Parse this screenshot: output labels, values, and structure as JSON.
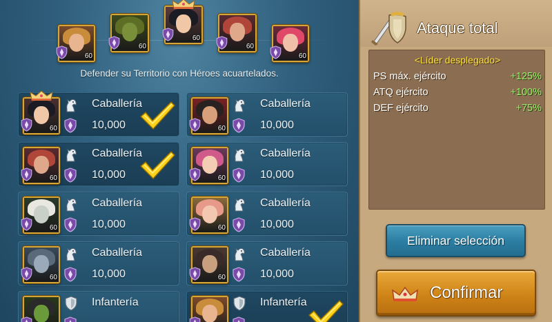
{
  "leaders": [
    {
      "level": "60",
      "icon": "heroine-portrait-icon",
      "skin": "#e8b590",
      "hair": "#c98c3a",
      "bg": "#7b4a2a"
    },
    {
      "level": "60",
      "icon": "golem-portrait-icon",
      "skin": "#7a8f3a",
      "hair": "#5e6f25",
      "bg": "#3d4a1a"
    },
    {
      "level": "60",
      "icon": "leader-heroine-portrait-icon",
      "skin": "#f0c8a8",
      "hair": "#1b1b24",
      "bg": "#5d3a3a"
    },
    {
      "level": "60",
      "icon": "mask-heroine-portrait-icon",
      "skin": "#e0a88a",
      "hair": "#b0463a",
      "bg": "#5a2a30"
    },
    {
      "level": "60",
      "icon": "redhead-portrait-icon",
      "skin": "#f1c0a8",
      "hair": "#e0486a",
      "bg": "#6a2a3a"
    }
  ],
  "subtitle": "Defender su Territorio con Héroes acuartelados.",
  "cards": [
    {
      "level": "60",
      "troop": "Caballería",
      "amount": "10,000",
      "type": "cavalry",
      "selected": true,
      "leader": true,
      "skin": "#f0c8a8",
      "hair": "#1b1b24",
      "bg": "#4a3030",
      "icon": "leader-heroine-portrait-icon"
    },
    {
      "level": "60",
      "troop": "Caballería",
      "amount": "10,000",
      "type": "cavalry",
      "selected": false,
      "leader": false,
      "skin": "#d8a07a",
      "hair": "#2a2220",
      "bg": "#7a2222",
      "icon": "bearded-warrior-portrait-icon"
    },
    {
      "level": "60",
      "troop": "Caballería",
      "amount": "10,000",
      "type": "cavalry",
      "selected": true,
      "leader": false,
      "skin": "#e0a88a",
      "hair": "#b0463a",
      "bg": "#5a2a30",
      "icon": "mask-heroine-portrait-icon"
    },
    {
      "level": "60",
      "troop": "Caballería",
      "amount": "10,000",
      "type": "cavalry",
      "selected": false,
      "leader": false,
      "skin": "#f5cdb5",
      "hair": "#d05a8a",
      "bg": "#6a3a5a",
      "icon": "pink-girl-portrait-icon"
    },
    {
      "level": "60",
      "troop": "Caballería",
      "amount": "10,000",
      "type": "cavalry",
      "selected": false,
      "leader": false,
      "skin": "#c8d0c8",
      "hair": "#e8e8e0",
      "bg": "#2a3a2a",
      "icon": "white-hair-warrior-portrait-icon"
    },
    {
      "level": "60",
      "troop": "Caballería",
      "amount": "10,000",
      "type": "cavalry",
      "selected": false,
      "leader": false,
      "skin": "#f2c8b0",
      "hair": "#e89a8a",
      "bg": "#8a6a3a",
      "icon": "pink-creature-portrait-icon"
    },
    {
      "level": "60",
      "troop": "Caballería",
      "amount": "10,000",
      "type": "cavalry",
      "selected": false,
      "leader": false,
      "skin": "#9aaab8",
      "hair": "#5a6a7a",
      "bg": "#3a4a5a",
      "icon": "ice-mage-portrait-icon"
    },
    {
      "level": "60",
      "troop": "Caballería",
      "amount": "10,000",
      "type": "cavalry",
      "selected": false,
      "leader": false,
      "skin": "#c8a080",
      "hair": "#3a2a2a",
      "bg": "#4a3a30",
      "icon": "hooded-elder-portrait-icon"
    },
    {
      "level": "",
      "troop": "Infantería",
      "amount": "",
      "type": "infantry",
      "selected": false,
      "leader": false,
      "skin": "#6a9a3a",
      "hair": "#2a2a2a",
      "bg": "#2a3a1a",
      "icon": "green-witch-portrait-icon"
    },
    {
      "level": "",
      "troop": "Infantería",
      "amount": "",
      "type": "infantry",
      "selected": true,
      "leader": false,
      "skin": "#e8b590",
      "hair": "#c98c3a",
      "bg": "#7b4a2a",
      "icon": "heroine-portrait-icon"
    }
  ],
  "panel": {
    "title": "Ataque total",
    "leader_heading": "<Líder desplegado>",
    "bonuses": [
      {
        "label": "PS máx. ejército",
        "value": "+125%"
      },
      {
        "label": "ATQ ejército",
        "value": "+100%"
      },
      {
        "label": "DEF ejército",
        "value": "+75%"
      }
    ],
    "clear_label": "Eliminar selección",
    "confirm_label": "Confirmar"
  },
  "colors": {
    "accent_gold": "#d6a637",
    "check_yellow": "#ffd21a",
    "bonus_green": "#9cf06a",
    "leader_heading_yellow": "#ffe23c",
    "defense_badge_purple": "#7a4aa8"
  }
}
